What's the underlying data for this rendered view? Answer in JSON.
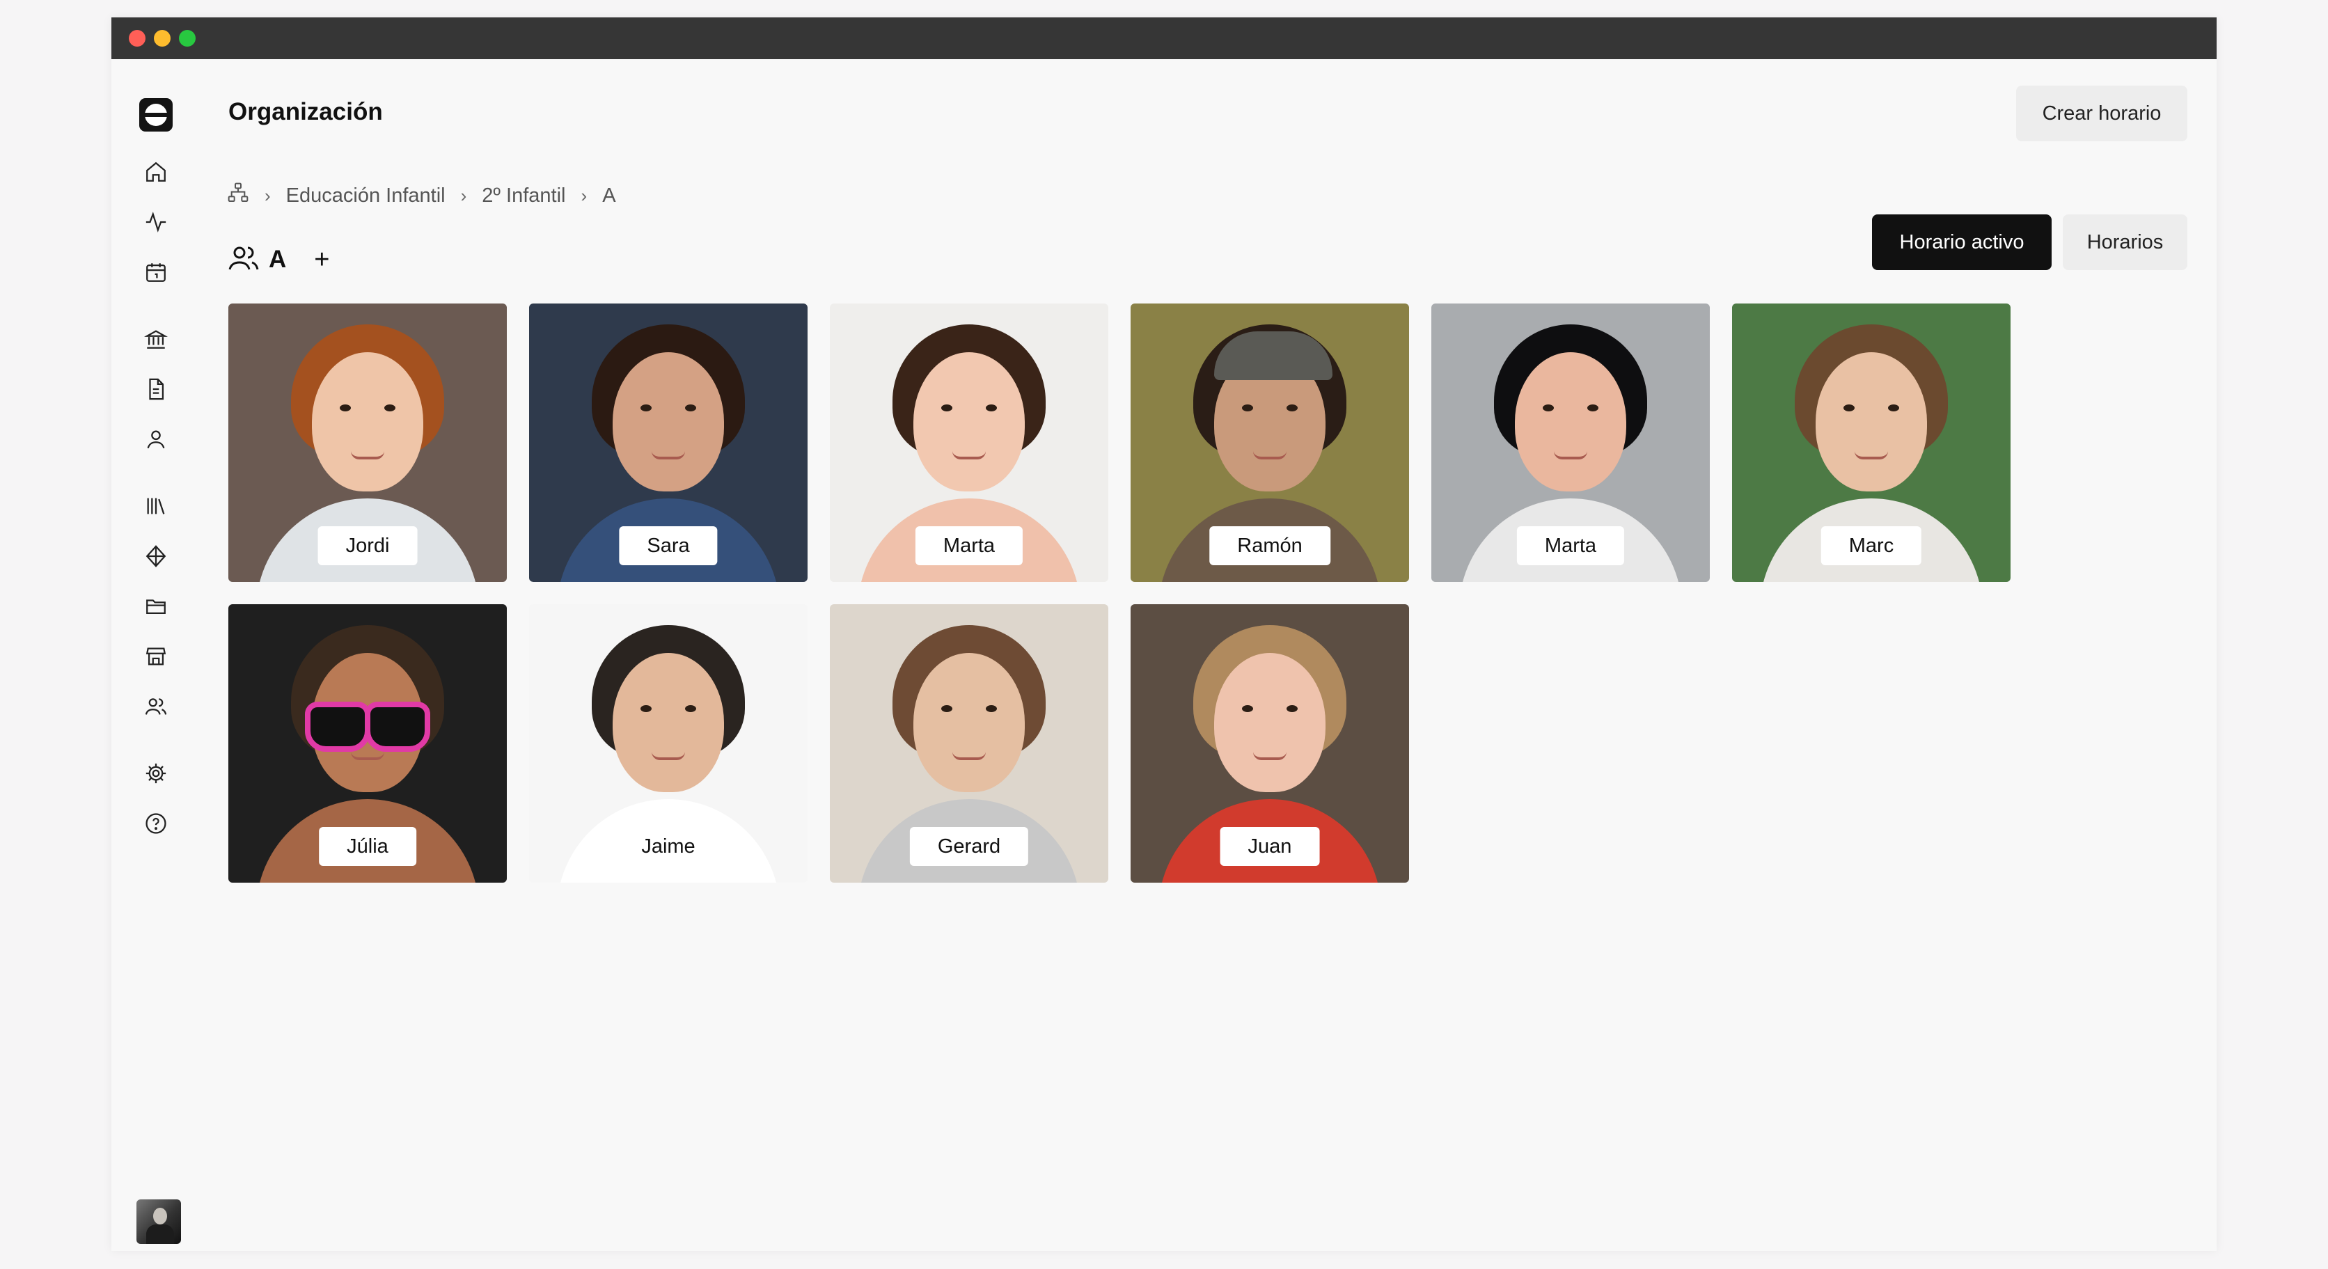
{
  "page": {
    "title": "Organización",
    "create_schedule_label": "Crear horario"
  },
  "breadcrumb": [
    "Educación Infantil",
    "2º Infantil",
    "A"
  ],
  "group": {
    "name": "A",
    "add_symbol": "+"
  },
  "tabs": {
    "active_schedule": "Horario activo",
    "schedules": "Horarios"
  },
  "sidebar": {
    "icons": [
      "home-icon",
      "activity-icon",
      "calendar-icon",
      "institution-icon",
      "document-icon",
      "user-icon",
      "library-icon",
      "compass-icon",
      "folder-icon",
      "store-icon",
      "users-icon",
      "settings-icon",
      "help-icon"
    ]
  },
  "students": [
    {
      "name": "Jordi",
      "bg": "#6b5a52",
      "hair": "#a4511f",
      "skin": "#efc5a8",
      "shirt": "#dfe3e6"
    },
    {
      "name": "Sara",
      "bg": "#2f3a4c",
      "hair": "#2b1a12",
      "skin": "#d4a184",
      "shirt": "#35507a"
    },
    {
      "name": "Marta",
      "bg": "#efeeec",
      "hair": "#3a2418",
      "skin": "#f2c8b0",
      "shirt": "#f0c1ab"
    },
    {
      "name": "Ramón",
      "bg": "#8a8146",
      "hair": "#2a1d16",
      "skin": "#c99a7b",
      "shirt": "#6d5a48"
    },
    {
      "name": "Marta",
      "bg": "#a9acaf",
      "hair": "#0e0e10",
      "skin": "#eab79e",
      "shirt": "#e8e8e8"
    },
    {
      "name": "Marc",
      "bg": "#4d7a45",
      "hair": "#6b4a2f",
      "skin": "#e9c1a4",
      "shirt": "#e8e6e2"
    },
    {
      "name": "Júlia",
      "bg": "#1f1f1f",
      "hair": "#3a2a1e",
      "skin": "#b97a55",
      "shirt": "#a56646"
    },
    {
      "name": "Jaime",
      "bg": "#f6f6f6",
      "hair": "#2a2420",
      "skin": "#e3b89a",
      "shirt": "#ffffff"
    },
    {
      "name": "Gerard",
      "bg": "#ddd6cc",
      "hair": "#6e4b34",
      "skin": "#e5bfa2",
      "shirt": "#c8c8c8"
    },
    {
      "name": "Juan",
      "bg": "#5c4e43",
      "hair": "#b08a5e",
      "skin": "#efc3ad",
      "shirt": "#d13b2d"
    }
  ]
}
